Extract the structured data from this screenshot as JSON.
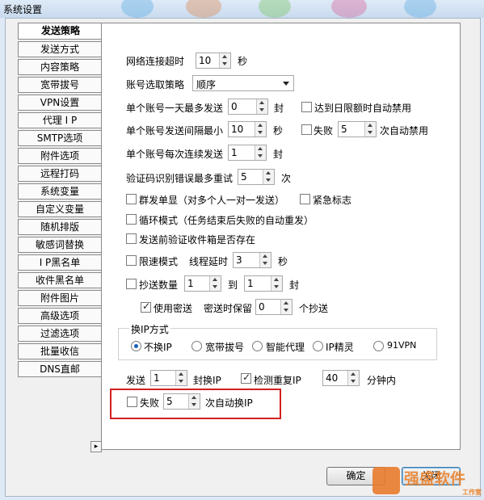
{
  "window": {
    "title": "系统设置"
  },
  "tabs": [
    {
      "label": "发送策略",
      "active": true
    },
    {
      "label": "发送方式"
    },
    {
      "label": "内容策略"
    },
    {
      "label": "宽带拔号"
    },
    {
      "label": "VPN设置"
    },
    {
      "label": "代理 I P"
    },
    {
      "label": "SMTP选项"
    },
    {
      "label": "附件选项"
    },
    {
      "label": "远程打码"
    },
    {
      "label": "系统变量"
    },
    {
      "label": "自定义变量"
    },
    {
      "label": "随机排版"
    },
    {
      "label": "敏感词替换"
    },
    {
      "label": "I P黑名单"
    },
    {
      "label": "收件黑名单"
    },
    {
      "label": "附件图片"
    },
    {
      "label": "高级选项"
    },
    {
      "label": "过滤选项"
    },
    {
      "label": "批量收信"
    },
    {
      "label": "DNS直邮"
    }
  ],
  "tab_scroll_arrow": "▸",
  "settings": {
    "net_timeout": {
      "label": "网络连接超时",
      "value": "10",
      "unit": "秒"
    },
    "account_strategy": {
      "label": "账号选取策略",
      "selected": "顺序"
    },
    "daily_max": {
      "label": "单个账号一天最多发送",
      "value": "0",
      "unit": "封"
    },
    "daily_limit_disable": {
      "label": "达到日限额时自动禁用",
      "checked": false
    },
    "min_interval": {
      "label": "单个账号发送间隔最小",
      "value": "10",
      "unit": "秒"
    },
    "fail_disable": {
      "label": "失败",
      "value": "5",
      "suffix": "次自动禁用",
      "checked": false
    },
    "consecutive": {
      "label": "单个账号每次连续发送",
      "value": "1",
      "unit": "封"
    },
    "captcha_retry": {
      "label": "验证码识别错误最多重试",
      "value": "5",
      "unit": "次"
    },
    "group_single": {
      "label": "群发单显（对多个人一对一发送）",
      "checked": false
    },
    "urgent": {
      "label": "紧急标志",
      "checked": false
    },
    "loop_mode": {
      "label": "循环模式（任务结束后失败的自动重发）",
      "checked": false
    },
    "verify_inbox": {
      "label": "发送前验证收件箱是否存在",
      "checked": false
    },
    "speed_limit": {
      "label": "限速模式",
      "thread_label": "线程延时",
      "value": "3",
      "unit": "秒",
      "checked": false
    },
    "cc_count": {
      "label": "抄送数量",
      "from": "1",
      "to_label": "到",
      "to": "1",
      "unit": "封",
      "checked": false
    },
    "bcc": {
      "label": "使用密送",
      "keep_label": "密送时保留",
      "value": "0",
      "suffix": "个抄送",
      "checked": true
    }
  },
  "ip_switch": {
    "title": "换IP方式",
    "options": [
      {
        "label": "不换IP",
        "selected": true
      },
      {
        "label": "宽带拔号"
      },
      {
        "label": "智能代理"
      },
      {
        "label": "IP精灵"
      },
      {
        "label": "91VPN"
      }
    ]
  },
  "send_ip": {
    "label": "发送",
    "value": "1",
    "suffix": "封换IP"
  },
  "detect_dup": {
    "label": "检测重复IP",
    "checked": true,
    "value": "40",
    "suffix": "分钟内"
  },
  "fail_switch": {
    "label": "失败",
    "value": "5",
    "suffix": "次自动换IP",
    "checked": false
  },
  "buttons": {
    "ok": "确定",
    "close": "关闭"
  },
  "watermark": {
    "main": "强盛软件",
    "sub": "工作室"
  },
  "colors": {
    "highlight": "#d32020",
    "accent": "#1a5fb4"
  }
}
